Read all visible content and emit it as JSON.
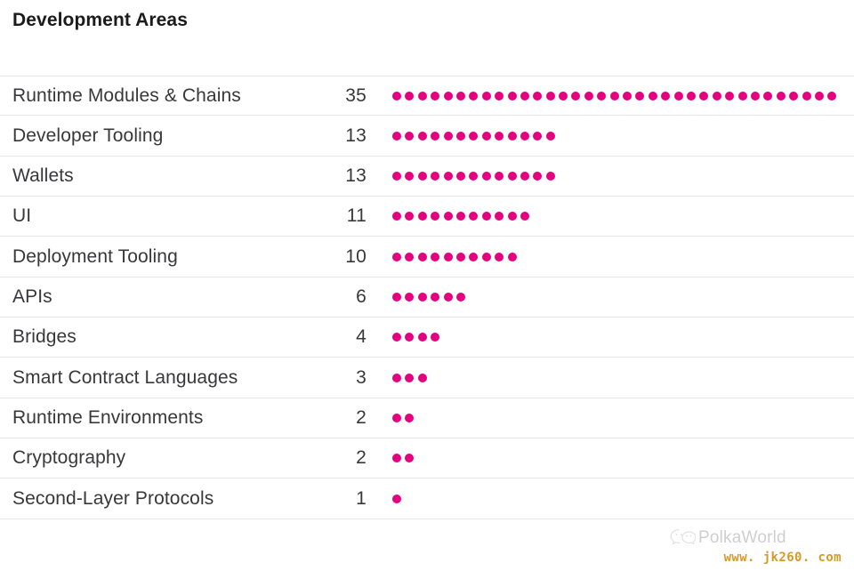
{
  "title": "Development Areas",
  "colors": {
    "dot": "#e4007f",
    "title_text": "#1b1b1b",
    "row_text": "#38383a",
    "divider": "#e6e6e6",
    "watermark_brand": "#cfcfcf",
    "watermark_url": "#d79a26",
    "background": "#ffffff"
  },
  "watermark": {
    "icon": "wechat-icon",
    "brand": "PolkaWorld",
    "url": "www. jk260. com"
  },
  "chart_data": {
    "type": "bar",
    "title": "Development Areas",
    "subtitle": "",
    "xlabel": "",
    "ylabel": "",
    "unit_marker": "dot",
    "dot_value": 1,
    "grid": false,
    "legend": null,
    "xlim": [
      0,
      35
    ],
    "categories": [
      "Runtime Modules & Chains",
      "Developer Tooling",
      "Wallets",
      "UI",
      "Deployment Tooling",
      "APIs",
      "Bridges",
      "Smart Contract Languages",
      "Runtime Environments",
      "Cryptography",
      "Second-Layer Protocols"
    ],
    "values": [
      35,
      13,
      13,
      11,
      10,
      6,
      4,
      3,
      2,
      2,
      1
    ],
    "rows": [
      {
        "label": "Runtime Modules & Chains",
        "value": 35
      },
      {
        "label": "Developer Tooling",
        "value": 13
      },
      {
        "label": "Wallets",
        "value": 13
      },
      {
        "label": "UI",
        "value": 11
      },
      {
        "label": "Deployment Tooling",
        "value": 10
      },
      {
        "label": "APIs",
        "value": 6
      },
      {
        "label": "Bridges",
        "value": 4
      },
      {
        "label": "Smart Contract Languages",
        "value": 3
      },
      {
        "label": "Runtime Environments",
        "value": 2
      },
      {
        "label": "Cryptography",
        "value": 2
      },
      {
        "label": "Second-Layer Protocols",
        "value": 1
      }
    ]
  }
}
